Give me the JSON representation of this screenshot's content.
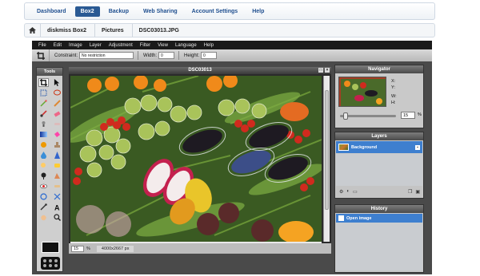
{
  "nav": {
    "tabs": [
      "Dashboard",
      "Box2",
      "Backup",
      "Web Sharing",
      "Account Settings",
      "Help"
    ],
    "active": "Box2"
  },
  "breadcrumb": {
    "items": [
      "diskmiss Box2",
      "Pictures",
      "DSC03013.JPG"
    ]
  },
  "editor": {
    "menu": [
      "File",
      "Edit",
      "Image",
      "Layer",
      "Adjustment",
      "Filter",
      "View",
      "Language",
      "Help"
    ],
    "options": {
      "constraint_label": "Constraint:",
      "constraint_value": "No restriction",
      "width_label": "Width:",
      "width_value": "0",
      "height_label": "Height:",
      "height_value": "0"
    },
    "tools_title": "Tools",
    "canvas": {
      "title": "DSC03013",
      "zoom": "15",
      "zoom_unit": "%",
      "dimensions": "4000x2667 px"
    },
    "navigator": {
      "title": "Navigator",
      "x_label": "X:",
      "y_label": "Y:",
      "w_label": "W:",
      "h_label": "H:",
      "zoom": "15",
      "zoom_unit": "%"
    },
    "layers": {
      "title": "Layers",
      "items": [
        "Background"
      ]
    },
    "history": {
      "title": "History",
      "items": [
        "Open image"
      ]
    }
  },
  "colors": {
    "accent": "#2a5a94",
    "selection": "#3e7fcf",
    "menubar": "#1a1a1a",
    "workspace": "#4a4a4a"
  }
}
